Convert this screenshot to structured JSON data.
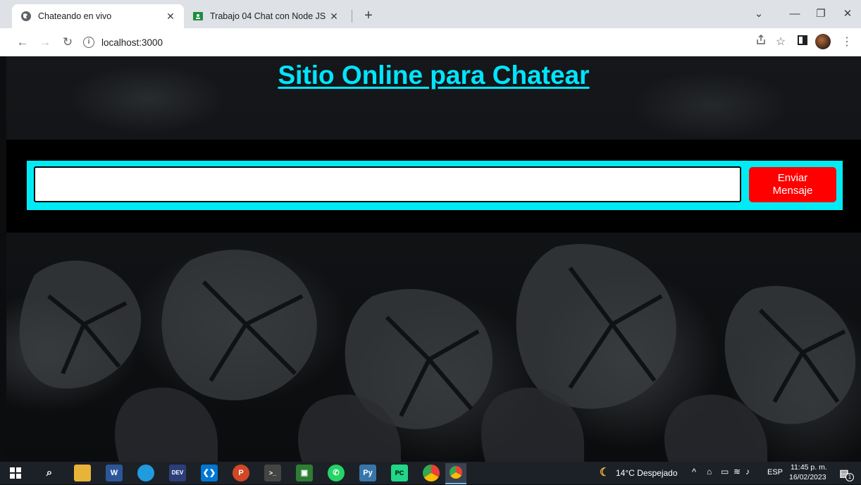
{
  "browser": {
    "tabs": [
      {
        "title": "Chateando en vivo",
        "active": true
      },
      {
        "title": "Trabajo 04 Chat con Node JS",
        "active": false
      }
    ],
    "new_tab_label": "+",
    "address": "localhost:3000"
  },
  "page": {
    "heading": "Sitio Online para Chatear",
    "message_input": {
      "value": "",
      "placeholder": ""
    },
    "send_button_label": "Enviar\nMensaje",
    "colors": {
      "heading": "#00e5ff",
      "box": "#00ecf5",
      "button": "#ff0000"
    }
  },
  "taskbar": {
    "apps": [
      "windows-start",
      "search",
      "file-explorer",
      "word",
      "edge",
      "dev-tools",
      "vscode",
      "powerpoint",
      "terminal",
      "task-app",
      "whatsapp",
      "python",
      "pycharm",
      "chrome",
      "chrome-profile"
    ],
    "weather": "14°C  Despejado",
    "language": "ESP",
    "time": "11:45 p. m.",
    "date": "16/02/2023",
    "notification_count": "1"
  }
}
